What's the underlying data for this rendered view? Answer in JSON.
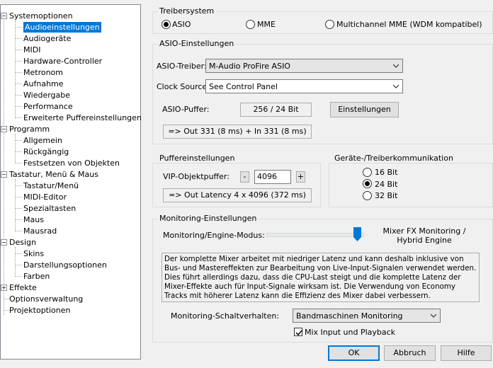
{
  "tree": {
    "items": [
      {
        "label": "Systemoptionen"
      },
      {
        "label": "Audioeinstellungen"
      },
      {
        "label": "Audiogeräte"
      },
      {
        "label": "MIDI"
      },
      {
        "label": "Hardware-Controller"
      },
      {
        "label": "Metronom"
      },
      {
        "label": "Aufnahme"
      },
      {
        "label": "Wiedergabe"
      },
      {
        "label": "Performance"
      },
      {
        "label": "Erweiterte Puffereinstellungen"
      },
      {
        "label": "Programm"
      },
      {
        "label": "Allgemein"
      },
      {
        "label": "Rückgängig"
      },
      {
        "label": "Festsetzen von Objekten"
      },
      {
        "label": "Tastatur, Menü & Maus"
      },
      {
        "label": "Tastatur/Menü"
      },
      {
        "label": "MIDI-Editor"
      },
      {
        "label": "Spezialtasten"
      },
      {
        "label": "Maus"
      },
      {
        "label": "Mausrad"
      },
      {
        "label": "Design"
      },
      {
        "label": "Skins"
      },
      {
        "label": "Darstellungsoptionen"
      },
      {
        "label": "Farben"
      },
      {
        "label": "Effekte"
      },
      {
        "label": "Optionsverwaltung"
      },
      {
        "label": "Projektoptionen"
      }
    ],
    "expander_minus": "−",
    "expander_plus": "+"
  },
  "treiber": {
    "title": "Treibersystem",
    "asio": "ASIO",
    "mme": "MME",
    "multichannel": "Multichannel MME (WDM kompatibel)"
  },
  "asio": {
    "title": "ASIO-Einstellungen",
    "driver_label": "ASIO-Treiber:",
    "driver_value": "M-Audio ProFire ASIO",
    "clock_label": "Clock Source:",
    "clock_value": "See Control Panel",
    "buffer_label": "ASIO-Puffer:",
    "buffer_value": "256 / 24 Bit",
    "settings_button": "Einstellungen",
    "latency": "=> Out 331 (8 ms) + In 331 (8 ms)"
  },
  "puffer": {
    "title": "Puffereinstellungen",
    "vip_label": "VIP-Objektpuffer:",
    "minus": "-",
    "plus": "+",
    "vip_value": "4096",
    "latency": "=> Out Latency 4 x 4096 (372 ms)"
  },
  "geraete": {
    "title": "Geräte-/Treiberkommunikation",
    "bit16": "16 Bit",
    "bit24": "24 Bit",
    "bit32": "32 Bit"
  },
  "monitoring": {
    "title": "Monitoring-Einstellungen",
    "mode_label": "Monitoring/Engine-Modus:",
    "mode_value_line1": "Mixer FX Monitoring /",
    "mode_value_line2": "Hybrid Engine",
    "description": "Der komplette Mixer arbeitet mit niedriger Latenz und kann deshalb inklusive von Bus- und Mastereffekten zur Bearbeitung von Live-Input-Signalen verwendet werden. Dies führt allerdings dazu, dass die CPU-Last steigt und die komplette Latenz der Mixer-Effekte auch für Input-Signale wirksam ist. Die Verwendung von Economy Tracks mit höherer Latenz kann die Effizienz des Mixer dabei verbessern.",
    "switch_label": "Monitoring-Schaltverhalten:",
    "switch_value": "Bandmaschinen Monitoring",
    "mix_label": "Mix Input und Playback"
  },
  "footer": {
    "ok": "OK",
    "cancel": "Abbruch",
    "help": "Hilfe"
  }
}
